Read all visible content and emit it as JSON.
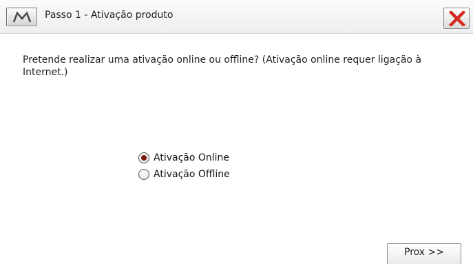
{
  "window": {
    "title": "Passo 1 - Ativação produto",
    "menu_icon": "m-logo-icon",
    "close_icon": "red-x-close-icon"
  },
  "main": {
    "question": "Pretende realizar uma ativação online ou offline? (Ativação online requer ligação à Internet.)",
    "options": [
      {
        "label": "Ativação Online",
        "selected": true
      },
      {
        "label": "Ativação Offline",
        "selected": false
      }
    ]
  },
  "footer": {
    "next_label": "Prox >>"
  },
  "colors": {
    "close_x": "#d42a20",
    "radio_dot": "#7a1c10"
  }
}
